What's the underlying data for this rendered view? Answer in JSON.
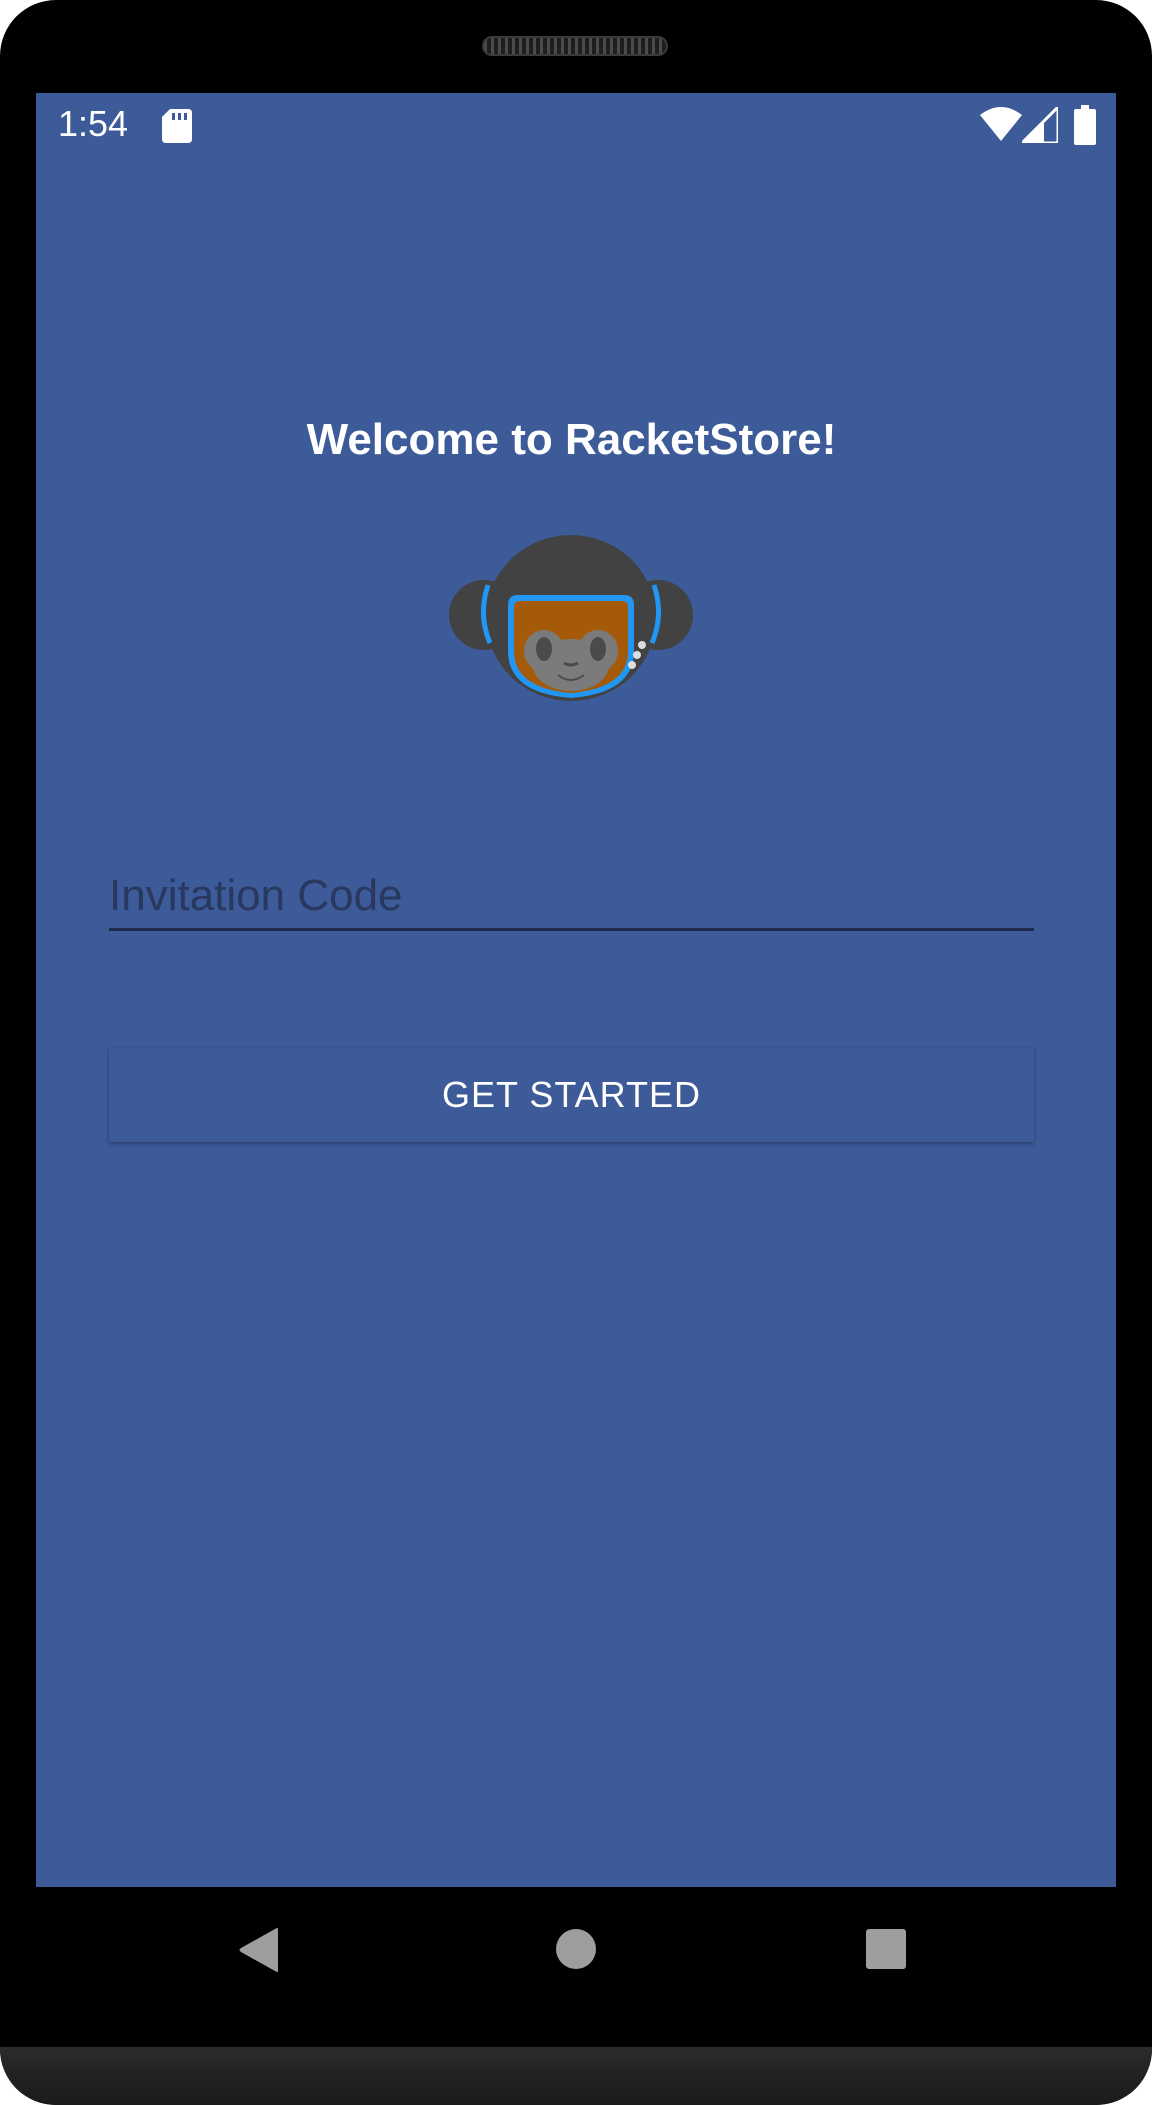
{
  "status_bar": {
    "time": "1:54",
    "icons": [
      "sd-card-icon",
      "wifi-icon",
      "cell-signal-icon",
      "battery-icon"
    ]
  },
  "welcome": {
    "title": "Welcome to RacketStore!"
  },
  "logo": {
    "icon": "monkey-astronaut-logo"
  },
  "invitation": {
    "placeholder": "Invitation Code",
    "value": ""
  },
  "actions": {
    "get_started_label": "GET STARTED"
  },
  "nav_bar": {
    "icons": [
      "back-icon",
      "home-icon",
      "recents-icon"
    ]
  },
  "colors": {
    "background": "#3d5a99",
    "underline": "#1f2a4c",
    "placeholder": "#28385f",
    "text": "#ffffff"
  }
}
